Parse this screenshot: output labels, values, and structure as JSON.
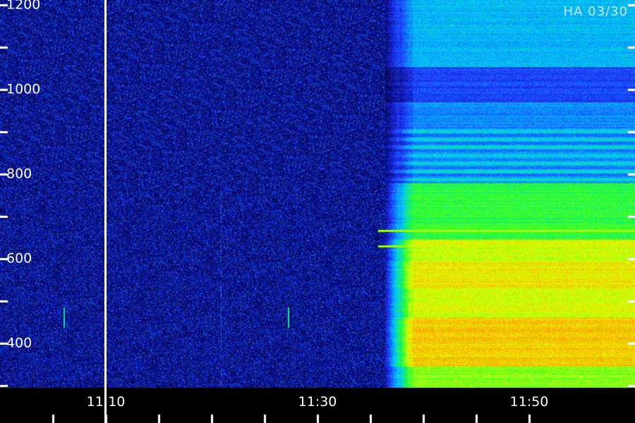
{
  "station_label": "HA 03/30",
  "chart_data": {
    "type": "heatmap",
    "title": "",
    "xlabel": "",
    "ylabel": "",
    "y_ticks": [
      400,
      600,
      800,
      1000,
      1200
    ],
    "x_ticks": [
      "11:10",
      "11:30",
      "11:50"
    ],
    "x_range": [
      "11:03",
      "11:53"
    ],
    "y_range": [
      290,
      1210
    ],
    "marker_time": "11:10",
    "burst_onset_time": "11:36",
    "colorscale": [
      "#00004a",
      "#1f33ff",
      "#00c8ff",
      "#20ff30",
      "#e8ff00",
      "#ff7a00"
    ],
    "colors": {
      "background": "#000000",
      "tick": "#ffffff"
    }
  }
}
